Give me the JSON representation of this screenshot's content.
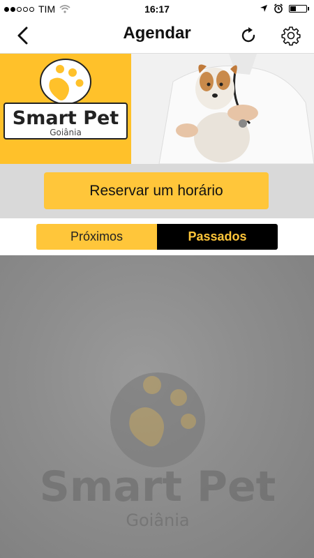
{
  "status_bar": {
    "carrier": "TIM",
    "time": "16:17",
    "signal_bars_filled": 2,
    "signal_bars_total": 5,
    "battery_level": 0.35
  },
  "nav": {
    "title": "Agendar",
    "back_icon": "chevron-left-icon",
    "refresh_icon": "refresh-icon",
    "settings_icon": "gear-icon"
  },
  "banner": {
    "brand_name": "Smart Pet",
    "brand_city": "Goiânia"
  },
  "reserve": {
    "label": "Reservar um horário"
  },
  "tabs": [
    {
      "label": "Próximos",
      "active": true
    },
    {
      "label": "Passados",
      "active": false
    }
  ],
  "watermark": {
    "brand_name": "Smart Pet",
    "brand_city": "Goiânia"
  },
  "colors": {
    "brand_yellow": "#ffc63a",
    "black": "#000000",
    "content_gray": "#8d8d8d"
  }
}
